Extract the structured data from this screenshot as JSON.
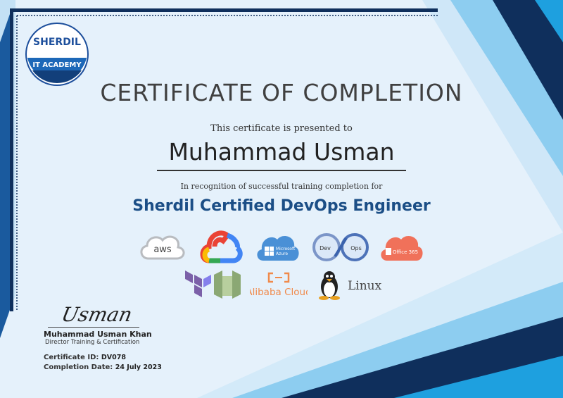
{
  "certificate": {
    "heading": "CERTIFICATE OF COMPLETION",
    "presented_text": "This certificate is presented to",
    "recipient_name": "Muhammad Usman",
    "recognition_text": "In recognition of successful training completion for",
    "course_name": "Sherdil Certified DevOps Engineer"
  },
  "academy_logo": {
    "brand": "SHERDIL",
    "subtitle": "IT ACADEMY"
  },
  "tech_logos": {
    "aws": "aws",
    "azure_line1": "Microsoft",
    "azure_line2": "Azure",
    "devops_left": "Dev",
    "devops_right": "Ops",
    "office": "Office 365",
    "alibaba": "Alibaba Cloud",
    "linux": "Linux"
  },
  "signatory": {
    "signature": "Usman",
    "name": "Muhammad Usman Khan",
    "title": "Director Training & Certification"
  },
  "details": {
    "id_label": "Certificate ID:",
    "id_value": "DV078",
    "date_label": "Completion Date:",
    "date_value": "24 July 2023"
  },
  "colors": {
    "navy": "#0f2f5c",
    "bright_blue": "#1ea0df",
    "light_blue": "#bfe1f7",
    "course_blue": "#1b4e86"
  }
}
